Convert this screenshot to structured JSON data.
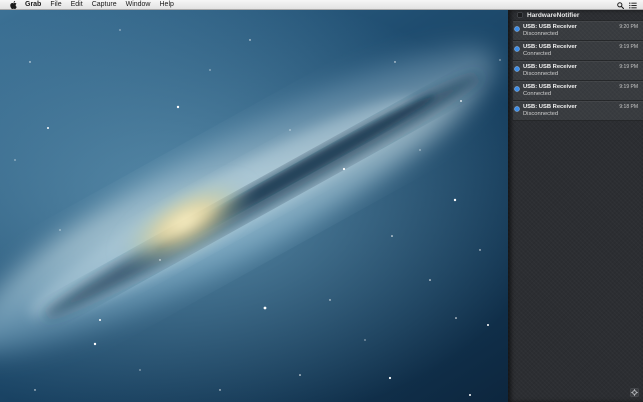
{
  "menubar": {
    "app_name": "Grab",
    "items": [
      "File",
      "Edit",
      "Capture",
      "Window",
      "Help"
    ],
    "apple_icon": "apple-logo-icon",
    "right_icons": [
      "spotlight-search-icon",
      "notification-center-icon"
    ]
  },
  "notification_center": {
    "app_name": "HardwareNotifier",
    "notifications": [
      {
        "title": "USB: USB Receiver",
        "body": "Disconnected",
        "time": "9:20 PM",
        "icon": "usb-device-icon"
      },
      {
        "title": "USB: USB Receiver",
        "body": "Connected",
        "time": "9:19 PM",
        "icon": "usb-device-icon"
      },
      {
        "title": "USB: USB Receiver",
        "body": "Disconnected",
        "time": "9:19 PM",
        "icon": "usb-device-icon"
      },
      {
        "title": "USB: USB Receiver",
        "body": "Connected",
        "time": "9:19 PM",
        "icon": "usb-device-icon"
      },
      {
        "title": "USB: USB Receiver",
        "body": "Disconnected",
        "time": "9:18 PM",
        "icon": "usb-device-icon"
      }
    ],
    "settings_icon": "gear-icon"
  },
  "colors": {
    "accent_blue": "#3e8ee8",
    "panel_background": "#2c2e32"
  }
}
